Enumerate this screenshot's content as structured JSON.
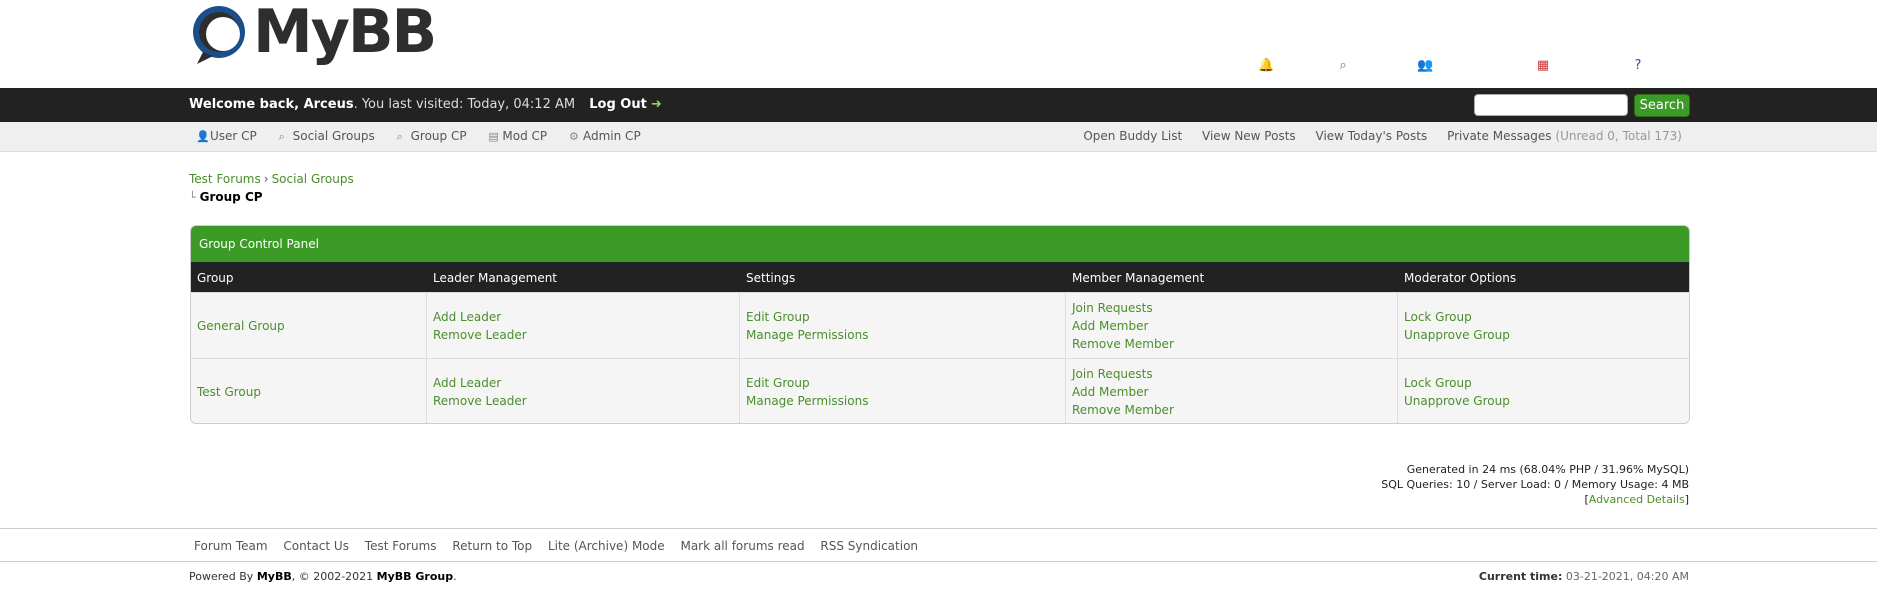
{
  "header": {
    "logo_text": "MyBB"
  },
  "welcome": {
    "prefix": "Welcome back, ",
    "username": "Arceus",
    "last_visit": ". You last visited: Today, 04:12 AM",
    "logout": "Log Out",
    "search_placeholder": "",
    "search_button": "Search"
  },
  "menu": {
    "left": [
      "User CP",
      "Social Groups",
      "Group CP",
      "Mod CP",
      "Admin CP"
    ],
    "right": {
      "buddy": "Open Buddy List",
      "new_posts": "View New Posts",
      "today_posts": "View Today's Posts",
      "pm": "Private Messages",
      "pm_count": "(Unread 0, Total 173)"
    }
  },
  "breadcrumb": {
    "items": [
      "Test Forums",
      "Social Groups"
    ],
    "current": "Group CP"
  },
  "panel": {
    "title": "Group Control Panel",
    "columns": [
      "Group",
      "Leader Management",
      "Settings",
      "Member Management",
      "Moderator Options"
    ],
    "rows": [
      {
        "group": "General Group",
        "leader": [
          "Add Leader",
          "Remove Leader"
        ],
        "settings": [
          "Edit Group",
          "Manage Permissions"
        ],
        "members": [
          "Join Requests",
          "Add Member",
          "Remove Member"
        ],
        "moderator": [
          "Lock Group",
          "Unapprove Group"
        ]
      },
      {
        "group": "Test Group",
        "leader": [
          "Add Leader",
          "Remove Leader"
        ],
        "settings": [
          "Edit Group",
          "Manage Permissions"
        ],
        "members": [
          "Join Requests",
          "Add Member",
          "Remove Member"
        ],
        "moderator": [
          "Lock Group",
          "Unapprove Group"
        ]
      }
    ]
  },
  "stats": {
    "generated": "Generated in 24 ms (68.04% PHP / 31.96% MySQL)",
    "queries": "SQL Queries: 10 / Server Load: 0 / Memory Usage: 4 MB",
    "advanced": "Advanced Details"
  },
  "footer": {
    "links": [
      "Forum Team",
      "Contact Us",
      "Test Forums",
      "Return to Top",
      "Lite (Archive) Mode",
      "Mark all forums read",
      "RSS Syndication"
    ],
    "powered_prefix": "Powered By ",
    "powered_mybb": "MyBB",
    "powered_mid": ", © 2002-2021 ",
    "powered_group": "MyBB Group",
    "powered_suffix": ".",
    "current_time_label": "Current time:",
    "current_time": "03-21-2021, 04:20 AM"
  },
  "colors": {
    "accent": "#3c9a27",
    "link": "#4b8e2c",
    "dark_bar": "#222222"
  }
}
